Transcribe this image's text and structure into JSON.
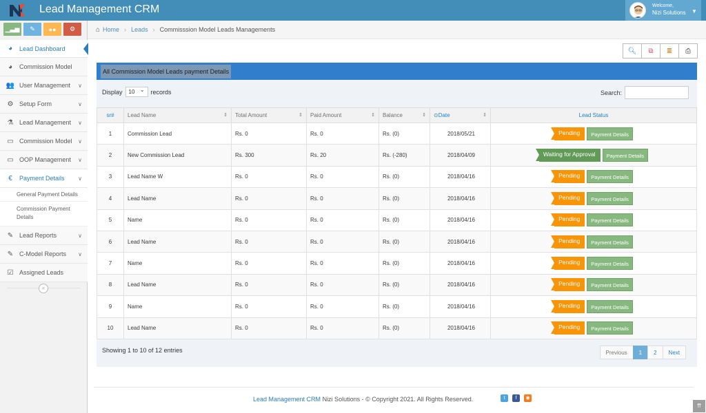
{
  "app": {
    "brand": "Lead Management CRM"
  },
  "user": {
    "welcome": "Welcome,",
    "name": "Nizi Solutions"
  },
  "sidebar": {
    "items": [
      {
        "label": "Lead Dashboard",
        "icon": "dashboard-icon"
      },
      {
        "label": "Commission Model",
        "icon": "dashboard-icon"
      },
      {
        "label": "User Management",
        "icon": "users-icon"
      },
      {
        "label": "Setup Form",
        "icon": "cogs-icon"
      },
      {
        "label": "Lead Management",
        "icon": "flask-icon"
      },
      {
        "label": "Commission Model",
        "icon": "desktop-icon"
      },
      {
        "label": "OOP Management",
        "icon": "desktop-icon"
      },
      {
        "label": "Payment Details",
        "icon": "euro-icon"
      },
      {
        "label": "Lead Reports",
        "icon": "edit-icon"
      },
      {
        "label": "C-Model Reports",
        "icon": "edit-icon"
      },
      {
        "label": "Assigned Leads",
        "icon": "check-square-icon"
      }
    ],
    "sub_items": [
      "General Payment Details",
      "Commission Payment Details"
    ]
  },
  "breadcrumb": {
    "home": "Home",
    "leads": "Leads",
    "current": "Commisssion Model Leads Managements"
  },
  "panel": {
    "title": "All Commission Model Leads payment Details"
  },
  "controls": {
    "display": "Display",
    "display_value": "10",
    "records": "records",
    "search": "Search:"
  },
  "table": {
    "headers": [
      "sr#",
      "Lead Name",
      "Total Amount",
      "Paid Amount",
      "Balance",
      "Date",
      "Lead Status"
    ],
    "action_label": "Payment Details",
    "rows": [
      {
        "sr": "1",
        "name": "Commission Lead",
        "total": "Rs. 0",
        "paid": "Rs. 0",
        "balance": "Rs. (0)",
        "date": "2018/05/21",
        "status": "Pending"
      },
      {
        "sr": "2",
        "name": "New Commission Lead",
        "total": "Rs. 300",
        "paid": "Rs. 20",
        "balance": "Rs. (-280)",
        "date": "2018/04/09",
        "status": "Waiting for Approval"
      },
      {
        "sr": "3",
        "name": "Lead Name W",
        "total": "Rs. 0",
        "paid": "Rs. 0",
        "balance": "Rs. (0)",
        "date": "2018/04/16",
        "status": "Pending"
      },
      {
        "sr": "4",
        "name": "Lead Name",
        "total": "Rs. 0",
        "paid": "Rs. 0",
        "balance": "Rs. (0)",
        "date": "2018/04/16",
        "status": "Pending"
      },
      {
        "sr": "5",
        "name": "Name",
        "total": "Rs. 0",
        "paid": "Rs. 0",
        "balance": "Rs. (0)",
        "date": "2018/04/16",
        "status": "Pending"
      },
      {
        "sr": "6",
        "name": "Lead Name",
        "total": "Rs. 0",
        "paid": "Rs. 0",
        "balance": "Rs. (0)",
        "date": "2018/04/16",
        "status": "Pending"
      },
      {
        "sr": "7",
        "name": "Name",
        "total": "Rs. 0",
        "paid": "Rs. 0",
        "balance": "Rs. (0)",
        "date": "2018/04/16",
        "status": "Pending"
      },
      {
        "sr": "8",
        "name": "Lead Name",
        "total": "Rs. 0",
        "paid": "Rs. 0",
        "balance": "Rs. (0)",
        "date": "2018/04/16",
        "status": "Pending"
      },
      {
        "sr": "9",
        "name": "Name",
        "total": "Rs. 0",
        "paid": "Rs. 0",
        "balance": "Rs. (0)",
        "date": "2018/04/16",
        "status": "Pending"
      },
      {
        "sr": "10",
        "name": "Lead Name",
        "total": "Rs. 0",
        "paid": "Rs. 0",
        "balance": "Rs. (0)",
        "date": "2018/04/16",
        "status": "Pending"
      }
    ]
  },
  "pagination": {
    "info": "Showing 1 to 10 of 12 entries",
    "previous": "Previous",
    "pages": [
      "1",
      "2"
    ],
    "next": "Next"
  },
  "footer": {
    "brand": "Lead Management CRM",
    "text": " Nizi Solutions - © Copyright 2021. All Rights Reserved."
  },
  "colors": {
    "navbar": "#438eb9",
    "pending": "#f89406",
    "approval": "#629b58",
    "payment_button": "#87b87f",
    "panel_header": "#307ecc"
  }
}
